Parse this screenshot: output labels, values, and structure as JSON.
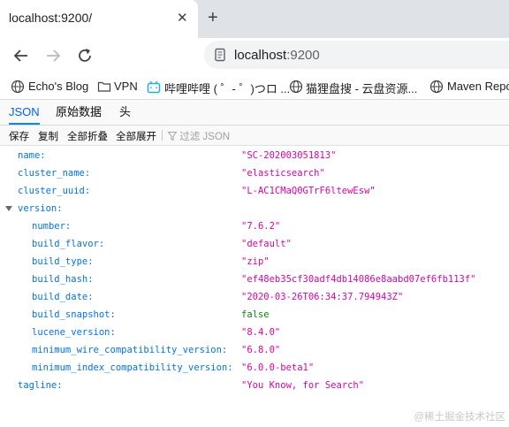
{
  "browser": {
    "tab_title": "localhost:9200/",
    "close_glyph": "✕",
    "new_tab_glyph": "+",
    "address_host": "localhost",
    "address_port": ":9200"
  },
  "bookmarks": [
    {
      "label": "Echo's Blog",
      "icon": "globe-icon"
    },
    {
      "label": "VPN",
      "icon": "folder-icon"
    },
    {
      "label": "哔哩哔哩 ( ゜- ゜)つロ ...",
      "icon": "bilibili-icon"
    },
    {
      "label": "猫狸盘搜 - 云盘资源...",
      "icon": "globe-icon"
    },
    {
      "label": "Maven Repo",
      "icon": "globe-icon"
    }
  ],
  "viewer": {
    "tabs": [
      "JSON",
      "原始数据",
      "头"
    ],
    "toolbar": {
      "save": "保存",
      "copy": "复制",
      "collapse_all": "全部折叠",
      "expand_all": "全部展开",
      "filter_placeholder": "过滤 JSON"
    }
  },
  "json_rows": [
    {
      "key": "name:",
      "value": "\"SC-202003051813\"",
      "type": "str",
      "indent": 0
    },
    {
      "key": "cluster_name:",
      "value": "\"elasticsearch\"",
      "type": "str",
      "indent": 0
    },
    {
      "key": "cluster_uuid:",
      "value": "\"L-AC1CMaQ0GTrF6ltewEsw\"",
      "type": "str",
      "indent": 0
    },
    {
      "key": "version:",
      "value": "",
      "type": "obj",
      "indent": 0
    },
    {
      "key": "number:",
      "value": "\"7.6.2\"",
      "type": "str",
      "indent": 1
    },
    {
      "key": "build_flavor:",
      "value": "\"default\"",
      "type": "str",
      "indent": 1
    },
    {
      "key": "build_type:",
      "value": "\"zip\"",
      "type": "str",
      "indent": 1
    },
    {
      "key": "build_hash:",
      "value": "\"ef48eb35cf30adf4db14086e8aabd07ef6fb113f\"",
      "type": "str",
      "indent": 1
    },
    {
      "key": "build_date:",
      "value": "\"2020-03-26T06:34:37.794943Z\"",
      "type": "str",
      "indent": 1
    },
    {
      "key": "build_snapshot:",
      "value": "false",
      "type": "bool",
      "indent": 1
    },
    {
      "key": "lucene_version:",
      "value": "\"8.4.0\"",
      "type": "str",
      "indent": 1
    },
    {
      "key": "minimum_wire_compatibility_version:",
      "value": "\"6.8.0\"",
      "type": "str",
      "indent": 1
    },
    {
      "key": "minimum_index_compatibility_version:",
      "value": "\"6.0.0-beta1\"",
      "type": "str",
      "indent": 1
    },
    {
      "key": "tagline:",
      "value": "\"You Know, for Search\"",
      "type": "str",
      "indent": 0
    }
  ],
  "watermark": "@稀土掘金技术社区"
}
